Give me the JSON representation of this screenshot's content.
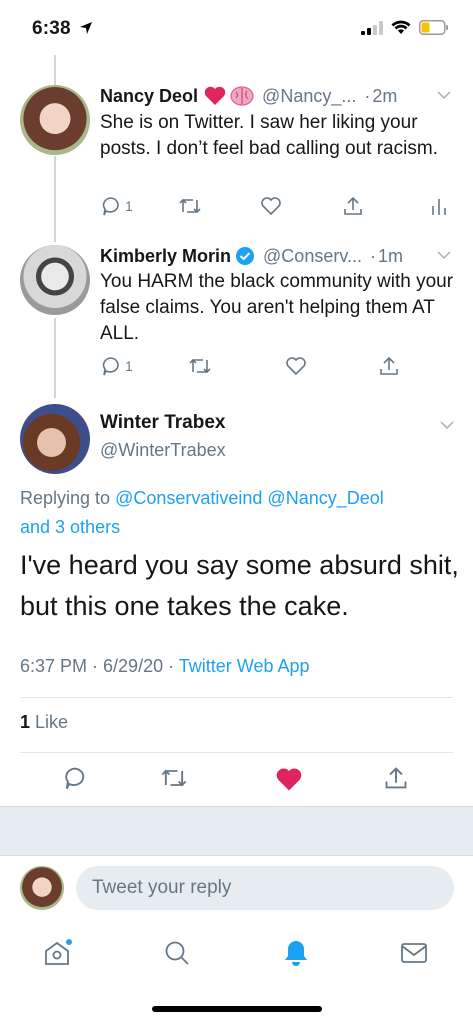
{
  "status_bar": {
    "time": "6:38"
  },
  "tweets": [
    {
      "name": "Nancy Deol",
      "handle": "@Nancy_...",
      "time": "2m",
      "text": "She is on Twitter. I saw her liking your posts. I don’t feel bad calling out racism.",
      "reply_count": "1"
    },
    {
      "name": "Kimberly Morin",
      "handle": "@Conserv...",
      "time": "1m",
      "text": "You HARM the black community with your false claims. You aren't helping them AT ALL.",
      "reply_count": "1"
    }
  ],
  "focus_tweet": {
    "name": "Winter Trabex",
    "handle": "@WinterTrabex",
    "replying_prefix": "Replying to",
    "replying_handles": "@Conservativeind @Nancy_Deol",
    "replying_others": "and 3 others",
    "text": "I've heard you say some absurd shit, but this one takes the cake.",
    "timestamp": "6:37 PM · 6/29/20 · ",
    "source": "Twitter Web App",
    "like_count": "1",
    "like_label": "Like"
  },
  "reply_bar": {
    "placeholder": "Tweet your reply"
  },
  "colors": {
    "accent": "#1da1f2",
    "like_red": "#e0245e",
    "muted": "#657786",
    "notification_blue": "#1da1f2"
  }
}
